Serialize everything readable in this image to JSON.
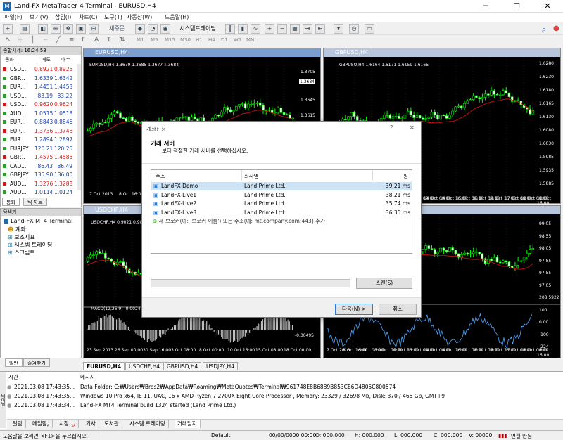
{
  "app": {
    "title": "Land-FX MetaTrader 4 Terminal - EURUSD,H4",
    "logo": "mt4-logo-icon"
  },
  "menu": [
    "파일(F)",
    "보기(V)",
    "삽입(I)",
    "차트(C)",
    "도구(T)",
    "자동창(W)",
    "도움말(H)"
  ],
  "toolbar": {
    "new_order": "새주문",
    "autotrade": "시스템트레이딩"
  },
  "timeframes": [
    "M1",
    "M5",
    "M15",
    "M30",
    "H1",
    "H4",
    "D1",
    "W1",
    "MN"
  ],
  "market_watch": {
    "title": "종합시세: 16:24:53",
    "col_symbol": "통화",
    "col_bid": "매도",
    "col_ask": "매수",
    "rows": [
      {
        "sym": "USD...",
        "bid": "0.8921",
        "ask": "0.8925",
        "dir": "dn"
      },
      {
        "sym": "GBP...",
        "bid": "1.6339",
        "ask": "1.6342",
        "dir": "up"
      },
      {
        "sym": "EUR...",
        "bid": "1.4451",
        "ask": "1.4453",
        "dir": "up"
      },
      {
        "sym": "USD...",
        "bid": "83.19",
        "ask": "83.22",
        "dir": "up"
      },
      {
        "sym": "USD...",
        "bid": "0.9620",
        "ask": "0.9624",
        "dir": "dn"
      },
      {
        "sym": "AUD...",
        "bid": "1.0515",
        "ask": "1.0518",
        "dir": "up"
      },
      {
        "sym": "EUR...",
        "bid": "0.8843",
        "ask": "0.8846",
        "dir": "up"
      },
      {
        "sym": "EUR...",
        "bid": "1.3736",
        "ask": "1.3748",
        "dir": "dn"
      },
      {
        "sym": "EUR...",
        "bid": "1.2894",
        "ask": "1.2897",
        "dir": "up"
      },
      {
        "sym": "EURJPY",
        "bid": "120.21",
        "ask": "120.25",
        "dir": "up"
      },
      {
        "sym": "GBP...",
        "bid": "1.4575",
        "ask": "1.4585",
        "dir": "dn"
      },
      {
        "sym": "CAD...",
        "bid": "86.43",
        "ask": "86.49",
        "dir": "up"
      },
      {
        "sym": "GBPJPY",
        "bid": "135.90",
        "ask": "136.00",
        "dir": "up"
      },
      {
        "sym": "AUD...",
        "bid": "1.3276",
        "ask": "1.3288",
        "dir": "dn"
      },
      {
        "sym": "AUD...",
        "bid": "1.0114",
        "ask": "1.0124",
        "dir": "up"
      }
    ],
    "tabs": [
      "통화",
      "틱 차트"
    ]
  },
  "navigator": {
    "title": "탐색기",
    "root": "Land-FX MT4 Terminal",
    "items": [
      "계좌",
      "보조지표",
      "시스템 트레이딩",
      "스크립트"
    ],
    "tabs": [
      "일반",
      "즐겨찾기"
    ]
  },
  "charts": [
    {
      "id": "eurusd",
      "title": "EURUSD,H4",
      "info": "EURUSD,H4  1.3679 1.3685 1.3677 1.3684",
      "prices": [
        "1.3705",
        "1.3684",
        "1.3645",
        "1.3615"
      ],
      "dates": [
        "7 Oct 2013",
        "8 Oct 16:00"
      ],
      "current": "1.3684"
    },
    {
      "id": "gbpusd",
      "title": "GBPUSD,H4",
      "info": "GBPUSD,H4  1.6164 1.6171 1.6159 1.6165",
      "prices": [
        "1.6280",
        "1.6230",
        "1.6180",
        "1.6165",
        "1.6130",
        "1.6080",
        "1.6030",
        "1.5985",
        "1.5935",
        "1.5885"
      ],
      "dates": [
        "7 Oct 2013",
        "8 Oct 16:00",
        "9 Oct 08:00",
        "10 Oct 00:00",
        "10 Oct 16:00",
        "11 Oct 08:00",
        "14 Oct 00:00",
        "14 Oct 16:00",
        "15 Oct 08:00",
        "16 Oct 00:00",
        "16 Oct 16:00",
        "17 Oct 08:00",
        "18 Oct 00:00",
        "18 Oct 16:00"
      ],
      "current": "1.6165"
    },
    {
      "id": "usdchf",
      "title": "USDCHF,H4",
      "info": "USDCHF,H4  0.9021 0.9023",
      "macd": "MACD(12,26,9) -0.00240 -0.00",
      "prices": [
        "-0.00495"
      ],
      "dates": [
        "23 Sep 2013",
        "26 Sep 00:00",
        "30 Sep 16:00",
        "3 Oct 08:00",
        "8 Oct 00:00",
        "10 Oct 16:00",
        "15 Oct 08:00",
        "18 Oct 00:00"
      ]
    },
    {
      "id": "usdjpy",
      "title": "USDJPY,H4",
      "prices": [
        "99.05",
        "98.55",
        "98.05",
        "97.85",
        "97.55",
        "97.05",
        "208.5922",
        "100",
        "0.00",
        "-100",
        "-224"
      ],
      "dates": [
        "7 Oct 2013",
        "8 Oct 16:00",
        "9 Oct 08:00",
        "10 Oct 00:00",
        "10 Oct 16:00",
        "11 Oct 08:00",
        "14 Oct 00:00",
        "14 Oct 16:00",
        "15 Oct 08:00",
        "16 Oct 00:00",
        "16 Oct 16:00",
        "17 Oct 08:00",
        "18 Oct 00:00",
        "18 Oct 16:00"
      ],
      "current": "97.85"
    }
  ],
  "chart_tabs": [
    "EURUSD,H4",
    "USDCHF,H4",
    "GBPUSD,H4",
    "USDJPY,H4"
  ],
  "dialog": {
    "title": "계좌신청",
    "help": "?",
    "close": "✕",
    "heading": "거래 서버",
    "subheading": "보다 적절한 거래 서버를 선택하십시오:",
    "col_addr": "주소",
    "col_company": "회사명",
    "col_ping": "핑",
    "servers": [
      {
        "addr": "LandFX-Demo",
        "company": "Land Prime Ltd.",
        "ping": "39.21 ms",
        "selected": true
      },
      {
        "addr": "LandFX-Live1",
        "company": "Land Prime Ltd.",
        "ping": "38.21 ms"
      },
      {
        "addr": "LandFX-Live2",
        "company": "Land Prime Ltd.",
        "ping": "35.74 ms"
      },
      {
        "addr": "LandFX-Live3",
        "company": "Land Prime Ltd.",
        "ping": "36.35 ms"
      }
    ],
    "add_server": "새 브로커(예: '브로커 이름') 또는 주소(예: mt.company.com:443) 추가",
    "scan": "스캔(S)",
    "next": "다음(N) >",
    "cancel": "취소"
  },
  "terminal": {
    "col_time": "시간",
    "col_msg": "메시지",
    "rows": [
      {
        "time": "2021.03.08 17:43:35...",
        "msg": "Data Folder: C:₩Users₩Bros2₩AppData₩Roaming₩MetaQuotes₩Terminal₩961748E8B6889B853CE6D4805C800574"
      },
      {
        "time": "2021.03.08 17:43:35...",
        "msg": "Windows 10 Pro x64, IE 11, UAC, 16 x AMD Ryzen 7 2700X Eight-Core Processor , Memory: 23329 / 32698 Mb, Disk: 370 / 465 Gb, GMT+9"
      },
      {
        "time": "2021.03.08 17:43:34...",
        "msg": "Land-FX MT4 Terminal build 1324 started (Land Prime Ltd.)"
      }
    ],
    "tabs": [
      "알람",
      "메일함",
      "시장",
      "기사",
      "도서관",
      "시스템 트레이딩",
      "거래일지"
    ],
    "mail_badge": "6",
    "market_badge": "138",
    "side": "터미널"
  },
  "status": {
    "help": "도움말을 보려면 <F1>을 누르십시오.",
    "profile": "Default",
    "datetime": "00/00/0000 00:00",
    "open": "O: 000.000",
    "high": "H: 000.000",
    "low": "L: 000.000",
    "close": "C: 000.000",
    "volume": "V: 00000",
    "conn": "연결 안됨"
  },
  "colors": {
    "bull": "#00ff00",
    "bear": "#ff2020",
    "ma": "#ff0000",
    "dialog_sel": "#cde4f7",
    "title_active": "#7b9fd1"
  }
}
